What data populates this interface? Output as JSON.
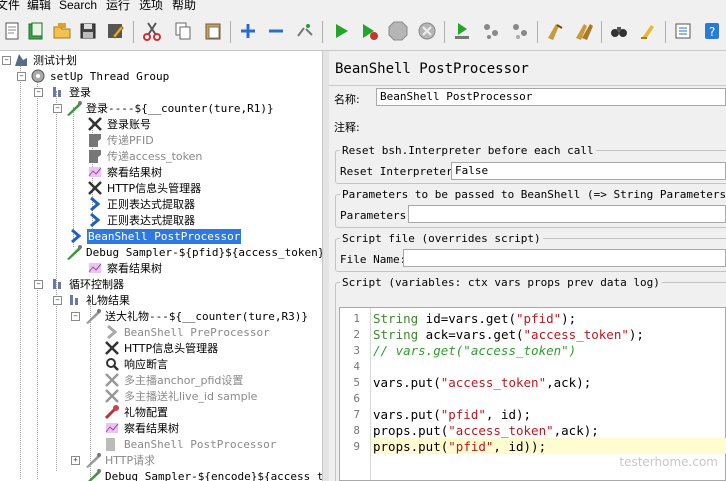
{
  "menu": [
    "文件",
    "编辑",
    "Search",
    "运行",
    "选项",
    "帮助"
  ],
  "tree": {
    "items": [
      {
        "label": "测试计划",
        "icon": "test-plan-icon"
      },
      {
        "label": "setUp Thread Group",
        "icon": "thread-group-icon"
      },
      {
        "label": "登录",
        "icon": "controller-icon"
      },
      {
        "label": "登录----${__counter(ture,R1)}",
        "icon": "sampler-icon"
      },
      {
        "label": "登录账号",
        "icon": "header-manager-icon"
      },
      {
        "label": "传递PFID",
        "icon": "postprocessor-icon"
      },
      {
        "label": "传递access_token",
        "icon": "postprocessor-icon"
      },
      {
        "label": "察看结果树",
        "icon": "listener-icon"
      },
      {
        "label": "HTTP信息头管理器",
        "icon": "header-manager-icon"
      },
      {
        "label": "正则表达式提取器",
        "icon": "extractor-icon"
      },
      {
        "label": "正则表达式提取器",
        "icon": "extractor-icon"
      },
      {
        "label": "BeanShell PostProcessor",
        "icon": "extractor-icon"
      },
      {
        "label": "Debug Sampler-${pfid}${access_token}",
        "icon": "sampler-icon"
      },
      {
        "label": "察看结果树",
        "icon": "listener-icon"
      },
      {
        "label": "循环控制器",
        "icon": "controller-icon"
      },
      {
        "label": "礼物结果",
        "icon": "controller-icon"
      },
      {
        "label": "送大礼物---${__counter(ture,R3)}",
        "icon": "sampler-icon"
      },
      {
        "label": "BeanShell PreProcessor",
        "icon": "preprocessor-icon"
      },
      {
        "label": "HTTP信息头管理器",
        "icon": "header-manager-icon"
      },
      {
        "label": "响应断言",
        "icon": "assertion-icon"
      },
      {
        "label": "多主播anchor_pfid设置",
        "icon": "header-manager-icon"
      },
      {
        "label": "多主播送礼live_id sample",
        "icon": "header-manager-icon"
      },
      {
        "label": "礼物配置",
        "icon": "config-icon"
      },
      {
        "label": "察看结果树",
        "icon": "listener-icon"
      },
      {
        "label": "BeanShell PostProcessor",
        "icon": "postprocessor-icon"
      },
      {
        "label": "HTTP请求",
        "icon": "sampler-icon"
      },
      {
        "label": "Debug Sampler-${encode}${access_token}",
        "icon": "sampler-icon"
      }
    ]
  },
  "panel": {
    "title": "BeanShell PostProcessor",
    "name_label": "名称:",
    "name_value": "BeanShell PostProcessor",
    "comment_label": "注释:",
    "reset_group": "Reset bsh.Interpreter before each call",
    "reset_label": "Reset Interpreter:",
    "reset_value": "False",
    "params_group": "Parameters to be passed to BeanShell (=> String Parameters and String []bsh.args)",
    "params_label": "Parameters:",
    "file_group": "Script file (overrides script)",
    "file_label": "File Name:",
    "script_group": "Script (variables: ctx vars props prev data log)"
  },
  "script_lines": [
    {
      "n": "1",
      "text": "String id=vars.get(\"pfid\");"
    },
    {
      "n": "2",
      "text": "String ack=vars.get(\"access_token\");"
    },
    {
      "n": "3",
      "text": "// vars.get(\"access_token\")"
    },
    {
      "n": "4",
      "text": ""
    },
    {
      "n": "5",
      "text": "vars.put(\"access_token\",ack);"
    },
    {
      "n": "6",
      "text": ""
    },
    {
      "n": "7",
      "text": "vars.put(\"pfid\", id);"
    },
    {
      "n": "8",
      "text": "props.put(\"access_token\",ack);"
    },
    {
      "n": "9",
      "text": "props.put(\"pfid\", id));"
    }
  ],
  "watermark": "testerhome.com",
  "colors": {
    "selection": "#2f78e0",
    "string": "#c0161e",
    "keyword": "#3a8b2a",
    "current_line": "#fefcd0"
  }
}
